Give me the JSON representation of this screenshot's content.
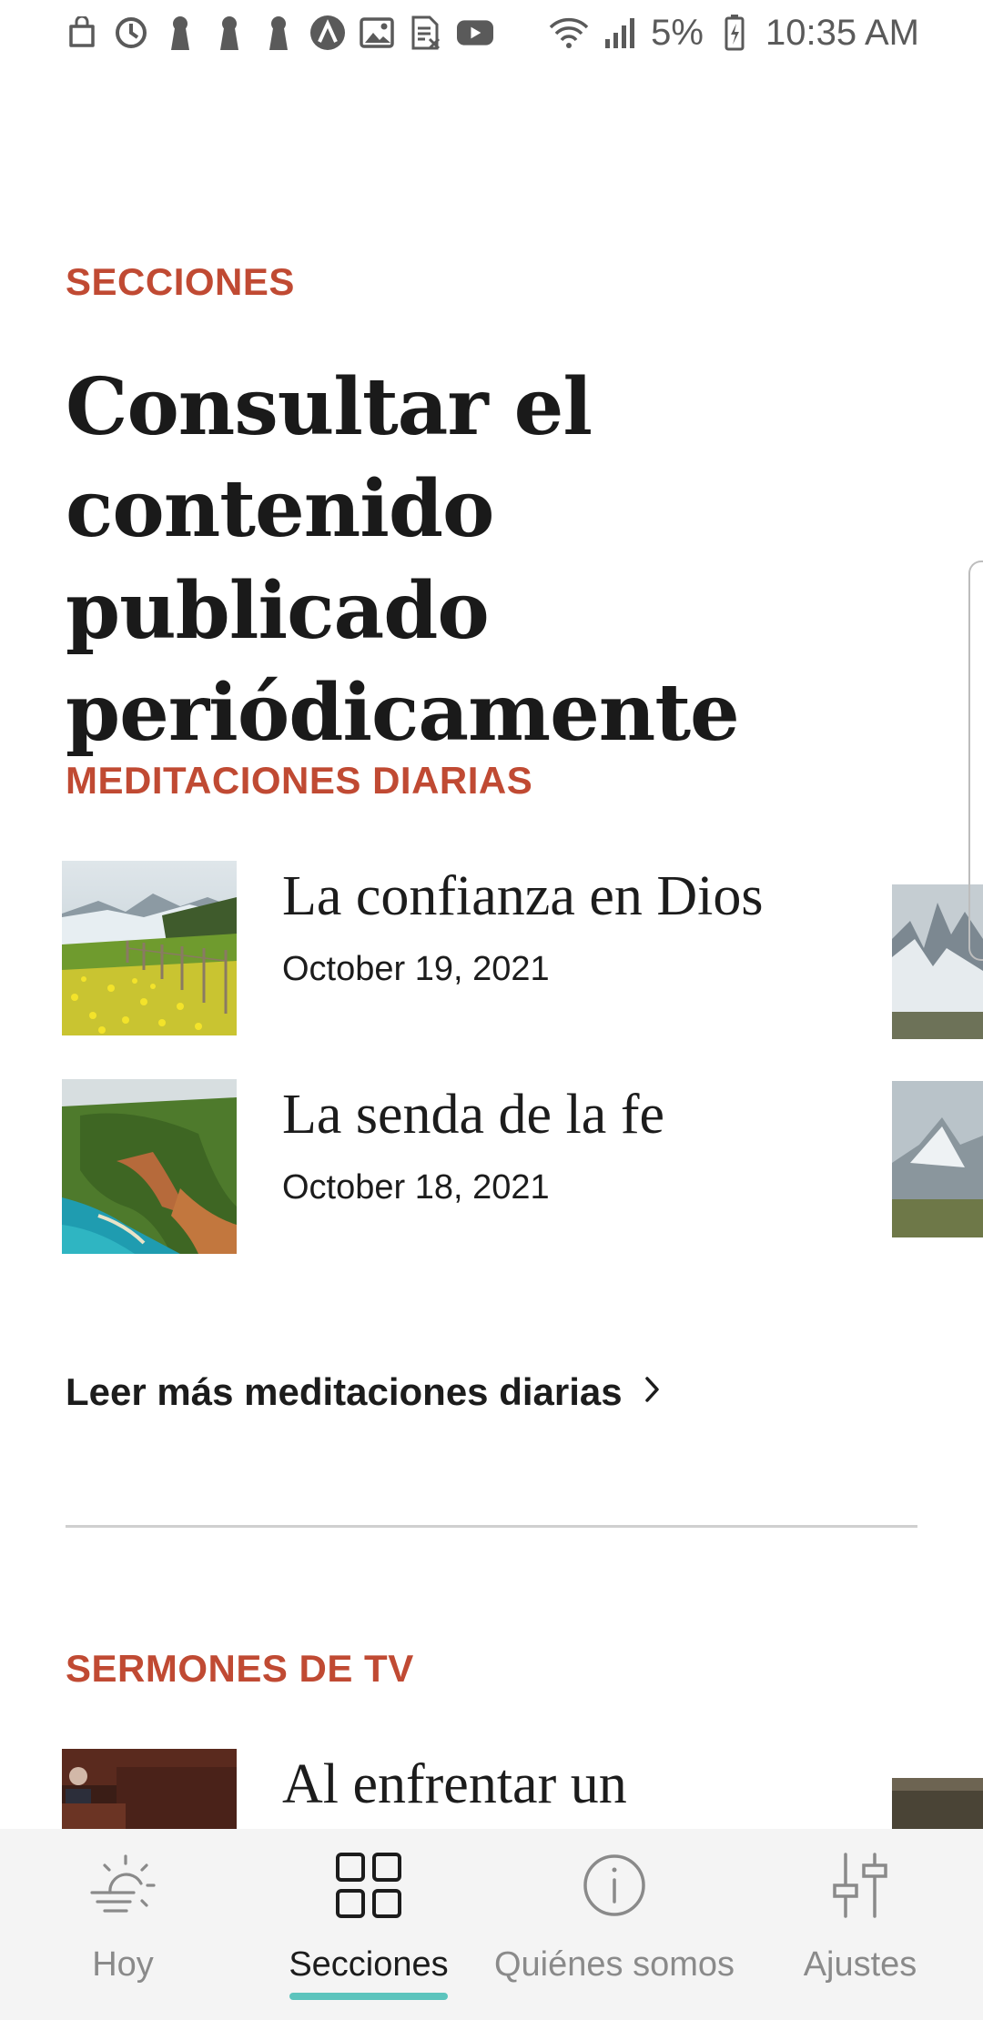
{
  "status_bar": {
    "battery": "5%",
    "time": "10:35 AM",
    "notification_icons": [
      "bag-icon",
      "sync-icon",
      "keyhole-icon",
      "keyhole-icon",
      "keyhole-icon",
      "arrow-up-circle-icon",
      "image-icon",
      "sim-card-icon",
      "youtube-icon"
    ],
    "system_icons": [
      "wifi-icon",
      "signal-icon",
      "battery-icon"
    ]
  },
  "header": {
    "eyebrow": "SECCIONES",
    "title": "Consultar el contenido publicado periódicamente"
  },
  "meditations": {
    "heading": "MEDITACIONES DIARIAS",
    "items": [
      {
        "title": "La confianza en Dios",
        "date": "October 19, 2021",
        "image": "meadow-landscape-image"
      },
      {
        "title": "La senda de la fe",
        "date": "October 18, 2021",
        "image": "coastal-cliffs-image"
      }
    ],
    "more_link": "Leer más meditaciones diarias"
  },
  "sermons": {
    "heading": "SERMONES DE TV",
    "items": [
      {
        "title": "Al enfrentar un",
        "image": "speaker-pulpit-image"
      }
    ]
  },
  "bottom_nav": {
    "items": [
      {
        "label": "Hoy",
        "icon": "sun-horizon-icon",
        "active": false
      },
      {
        "label": "Secciones",
        "icon": "grid-icon",
        "active": true
      },
      {
        "label": "Quiénes somos",
        "icon": "info-icon",
        "active": false
      },
      {
        "label": "Ajustes",
        "icon": "sliders-icon",
        "active": false
      }
    ]
  },
  "colors": {
    "accent": "#c04a33",
    "nav_indicator": "#5cc4bd",
    "nav_background": "#f4f4f4",
    "text": "#1c1c1c"
  }
}
